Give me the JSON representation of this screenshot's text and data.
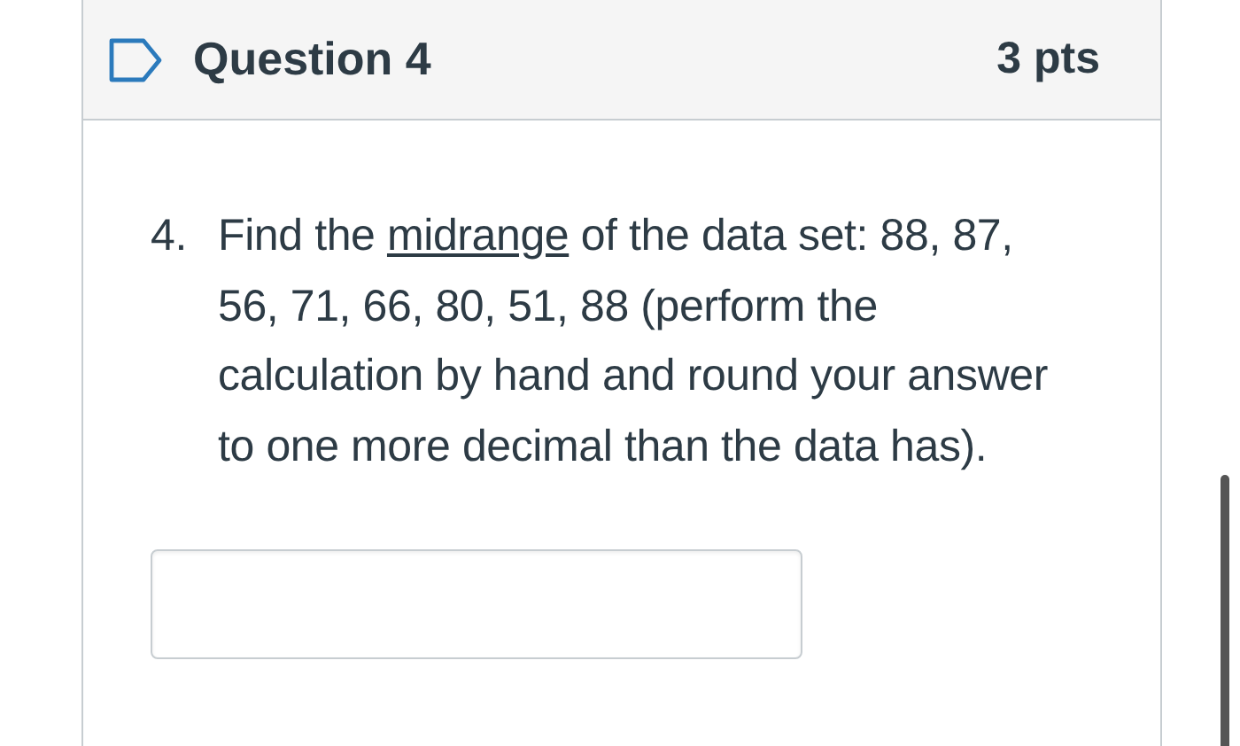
{
  "question": {
    "flagged": false,
    "title": "Question 4",
    "points": "3 pts"
  },
  "body": {
    "number": "4.",
    "text_before": "Find the ",
    "term": "midrange",
    "text_after": " of the data set:  88, 87, 56, 71, 66, 80, 51, 88 (perform the calculation by hand and round your answer to one more decimal than the data has)."
  }
}
